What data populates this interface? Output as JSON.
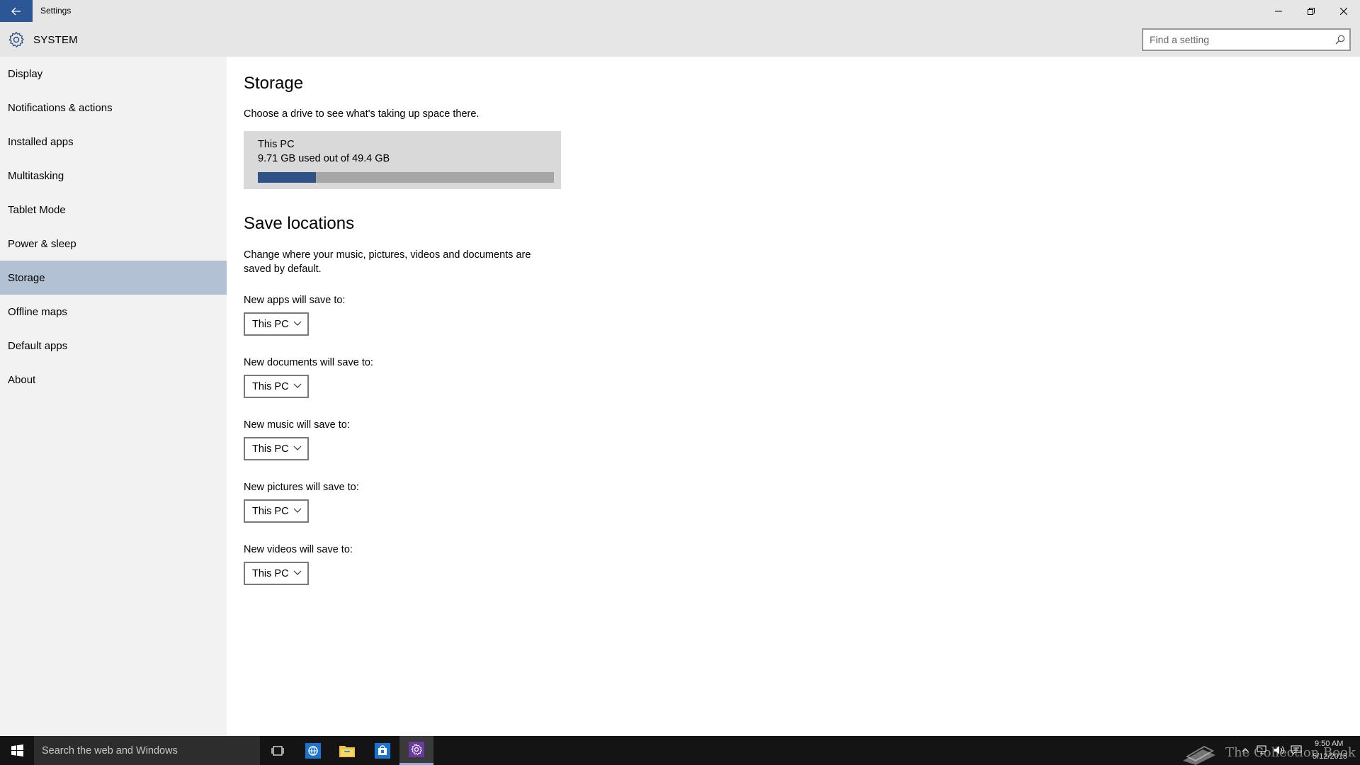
{
  "window": {
    "title": "Settings",
    "back_icon": "arrow-left-icon",
    "minimize_icon": "minimize-icon",
    "restore_icon": "restore-icon",
    "close_icon": "close-icon",
    "accent_color": "#2b5797"
  },
  "header": {
    "section_icon": "gear-icon",
    "section_title": "SYSTEM",
    "search_placeholder": "Find a setting",
    "search_value": ""
  },
  "sidebar": {
    "items": [
      {
        "label": "Display"
      },
      {
        "label": "Notifications & actions"
      },
      {
        "label": "Installed apps"
      },
      {
        "label": "Multitasking"
      },
      {
        "label": "Tablet Mode"
      },
      {
        "label": "Power & sleep"
      },
      {
        "label": "Storage"
      },
      {
        "label": "Offline maps"
      },
      {
        "label": "Default apps"
      },
      {
        "label": "About"
      }
    ],
    "selected": "Storage",
    "selected_color": "#b3c1d4"
  },
  "main": {
    "storage": {
      "title": "Storage",
      "description": "Choose a drive to see what's taking up space there.",
      "drive": {
        "name": "This PC",
        "usage_text": "9.71 GB used out of 49.4 GB",
        "used_gb": 9.71,
        "total_gb": 49.4,
        "bar_color": "#2f5387"
      }
    },
    "save_locations": {
      "title": "Save locations",
      "description_line1": "Change where your music, pictures, videos and documents are",
      "description_line2": "saved by default.",
      "settings": [
        {
          "label": "New apps will save to:",
          "value": "This PC"
        },
        {
          "label": "New documents will save to:",
          "value": "This PC"
        },
        {
          "label": "New music will save to:",
          "value": "This PC"
        },
        {
          "label": "New pictures will save to:",
          "value": "This PC"
        },
        {
          "label": "New videos will save to:",
          "value": "This PC"
        }
      ]
    }
  },
  "taskbar": {
    "start_icon": "windows-logo-icon",
    "search_text": "Search the web and Windows",
    "apps": [
      {
        "name": "task-view-icon"
      },
      {
        "name": "edge-browser-icon"
      },
      {
        "name": "file-explorer-icon"
      },
      {
        "name": "store-icon"
      },
      {
        "name": "settings-app-icon",
        "active": true
      }
    ],
    "watermark_text": "The Collection Book",
    "tray": {
      "icons": [
        "chevron-up-icon",
        "network-icon",
        "volume-icon",
        "action-center-icon"
      ],
      "time": "9:50 AM",
      "date": "5/12/2015"
    }
  }
}
